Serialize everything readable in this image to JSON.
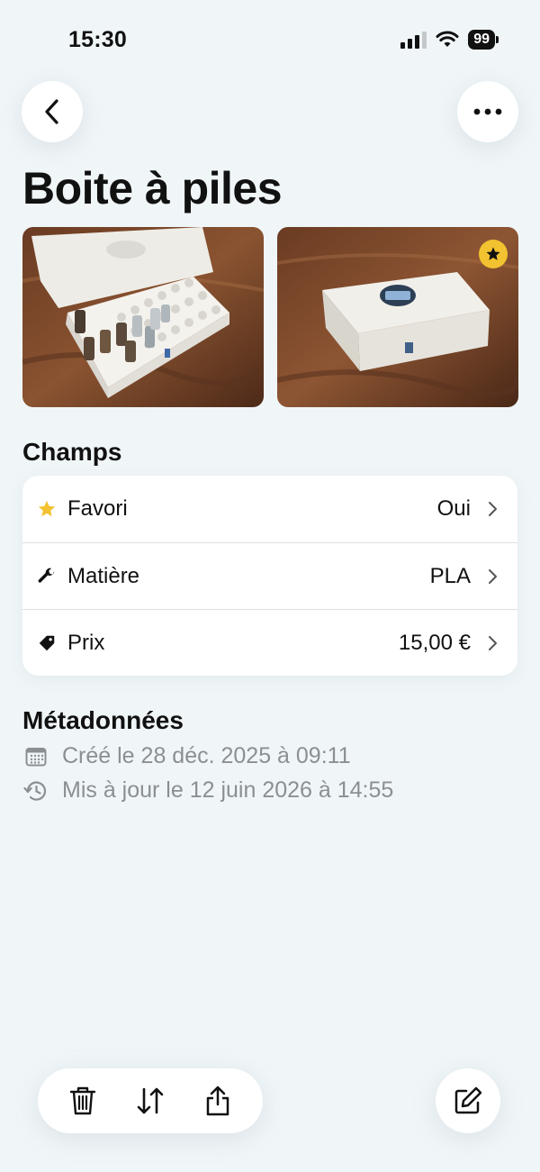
{
  "status_bar": {
    "time": "15:30",
    "battery": "99"
  },
  "nav": {
    "back_icon": "chevron-left-icon",
    "more_icon": "ellipsis-icon"
  },
  "title": "Boite à piles",
  "photos": [
    {
      "name": "battery-box-open-photo",
      "favorite": false
    },
    {
      "name": "battery-box-closed-photo",
      "favorite": true
    }
  ],
  "fields": {
    "section_title": "Champs",
    "rows": [
      {
        "icon": "star-icon",
        "label": "Favori",
        "value": "Oui"
      },
      {
        "icon": "wrench-icon",
        "label": "Matière",
        "value": "PLA"
      },
      {
        "icon": "tag-icon",
        "label": "Prix",
        "value": "15,00 €"
      }
    ]
  },
  "metadata": {
    "section_title": "Métadonnées",
    "created": "Créé le 28 déc. 2025 à 09:11",
    "updated": "Mis à jour le 12 juin 2026 à 14:55"
  },
  "toolbar": {
    "delete_icon": "trash-icon",
    "sort_icon": "swap-arrows-icon",
    "share_icon": "share-icon",
    "edit_icon": "edit-icon"
  },
  "colors": {
    "background": "#f0f6f8",
    "card": "#ffffff",
    "accent_star": "#f2c230",
    "muted_text": "#8b8f93"
  }
}
